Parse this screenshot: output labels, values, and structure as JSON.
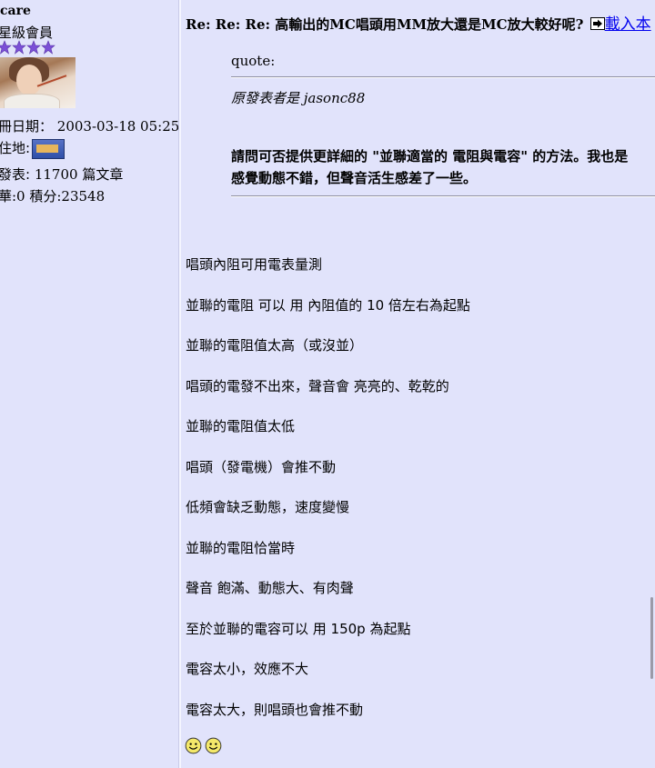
{
  "user": {
    "name": "care",
    "rank": "星級會員",
    "registered_label": "冊日期：",
    "registered_value": "2003-03-18 05:25",
    "location_label": "住地:",
    "posts_label": "發表:",
    "posts_value": "11700 篇文章",
    "essence_label": "華:0 積分:23548"
  },
  "post": {
    "title": "Re: Re: Re: 高輸出的MC唱頭用MM放大還是MC放大較好呢?",
    "download_label": "載入本",
    "quote": {
      "label": "quote:",
      "author": "原發表者是 jasonc88",
      "lines": [
        "請問可否提供更詳細的 \"並聯適當的 電阻與電容\" 的方法。我也是",
        "感覺動態不錯，但聲音活生感差了一些。"
      ]
    },
    "body": [
      "唱頭內阻可用電表量測",
      "並聯的電阻 可以 用 內阻值的 10 倍左右為起點",
      "並聯的電阻值太高（或沒並）",
      "唱頭的電發不出來，聲音會 亮亮的、乾乾的",
      "並聯的電阻值太低",
      "唱頭（發電機）會推不動",
      "低頻會缺乏動態，速度變慢",
      "並聯的電阻恰當時",
      "聲音 飽滿、動態大、有肉聲",
      "至於並聯的電容可以 用 150p 為起點",
      "電容太小，效應不大",
      "電容太大，則唱頭也會推不動"
    ]
  },
  "colors": {
    "background": "#e1e3fb",
    "star": "#7b4fd6",
    "link": "#0000ee"
  },
  "icons": [
    "star-icon",
    "avatar",
    "location-flag-icon",
    "post-arrow-icon",
    "smiley-icon"
  ]
}
